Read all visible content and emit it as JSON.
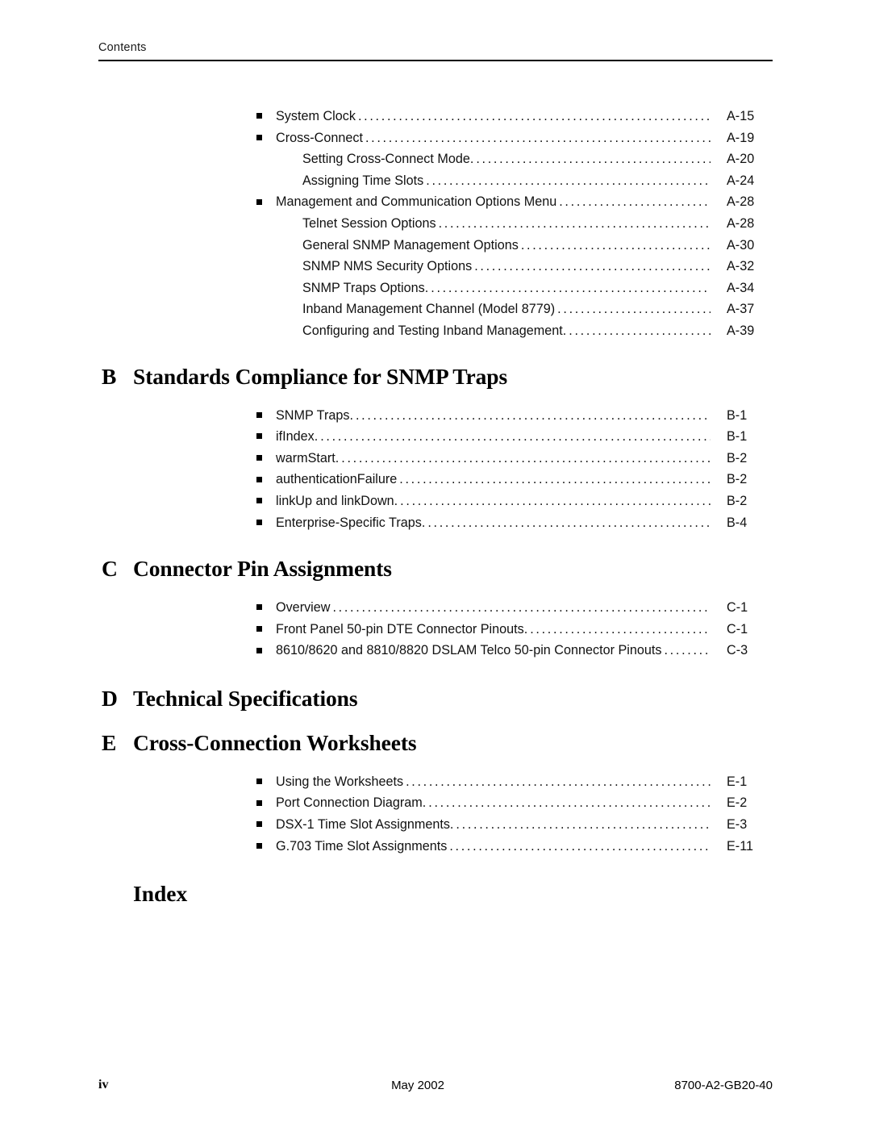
{
  "header": {
    "running_head": "Contents"
  },
  "toc": {
    "groups": [
      {
        "id": "appendix-a-continued",
        "heading": null,
        "entries": [
          {
            "bullet": true,
            "text": "System Clock",
            "page": "A-15"
          },
          {
            "bullet": true,
            "text": "Cross-Connect",
            "page": "A-19"
          },
          {
            "bullet": false,
            "text": "Setting Cross-Connect Mode.",
            "page": "A-20"
          },
          {
            "bullet": false,
            "text": "Assigning Time Slots",
            "page": "A-24"
          },
          {
            "bullet": true,
            "text": "Management and Communication Options Menu",
            "page": "A-28"
          },
          {
            "bullet": false,
            "text": "Telnet Session Options",
            "page": "A-28"
          },
          {
            "bullet": false,
            "text": "General SNMP Management Options",
            "page": "A-30"
          },
          {
            "bullet": false,
            "text": "SNMP NMS Security Options",
            "page": "A-32"
          },
          {
            "bullet": false,
            "text": "SNMP Traps Options.",
            "page": "A-34"
          },
          {
            "bullet": false,
            "text": "Inband Management Channel (Model 8779)",
            "page": "A-37"
          },
          {
            "bullet": false,
            "text": "Configuring and Testing Inband Management.",
            "page": "A-39"
          }
        ]
      },
      {
        "id": "appendix-b",
        "heading": {
          "letter": "B",
          "title": "Standards Compliance for SNMP Traps"
        },
        "entries": [
          {
            "bullet": true,
            "text": "SNMP Traps.",
            "page": "B-1"
          },
          {
            "bullet": true,
            "text": "ifIndex.",
            "page": "B-1"
          },
          {
            "bullet": true,
            "text": "warmStart.",
            "page": "B-2"
          },
          {
            "bullet": true,
            "text": "authenticationFailure",
            "page": "B-2"
          },
          {
            "bullet": true,
            "text": "linkUp and linkDown.",
            "page": "B-2"
          },
          {
            "bullet": true,
            "text": "Enterprise-Specific Traps.",
            "page": "B-4"
          }
        ]
      },
      {
        "id": "appendix-c",
        "heading": {
          "letter": "C",
          "title": "Connector Pin Assignments"
        },
        "entries": [
          {
            "bullet": true,
            "text": "Overview",
            "page": "C-1"
          },
          {
            "bullet": true,
            "text": "Front Panel 50-pin DTE Connector Pinouts.",
            "page": "C-1"
          },
          {
            "bullet": true,
            "text": "8610/8620 and 8810/8820 DSLAM Telco 50-pin Connector Pinouts",
            "page": "C-3"
          }
        ]
      },
      {
        "id": "appendix-d",
        "heading": {
          "letter": "D",
          "title": "Technical Specifications"
        },
        "entries": []
      },
      {
        "id": "appendix-e",
        "heading": {
          "letter": "E",
          "title": "Cross-Connection Worksheets"
        },
        "entries": [
          {
            "bullet": true,
            "text": "Using the Worksheets",
            "page": "E-1"
          },
          {
            "bullet": true,
            "text": "Port Connection Diagram.",
            "page": "E-2"
          },
          {
            "bullet": true,
            "text": "DSX-1 Time Slot Assignments.",
            "page": "E-3"
          },
          {
            "bullet": true,
            "text": "G.703 Time Slot Assignments",
            "page": "E-11"
          }
        ]
      }
    ],
    "index_heading": "Index"
  },
  "footer": {
    "page_number": "iv",
    "date": "May 2002",
    "document_number": "8700-A2-GB20-40"
  }
}
